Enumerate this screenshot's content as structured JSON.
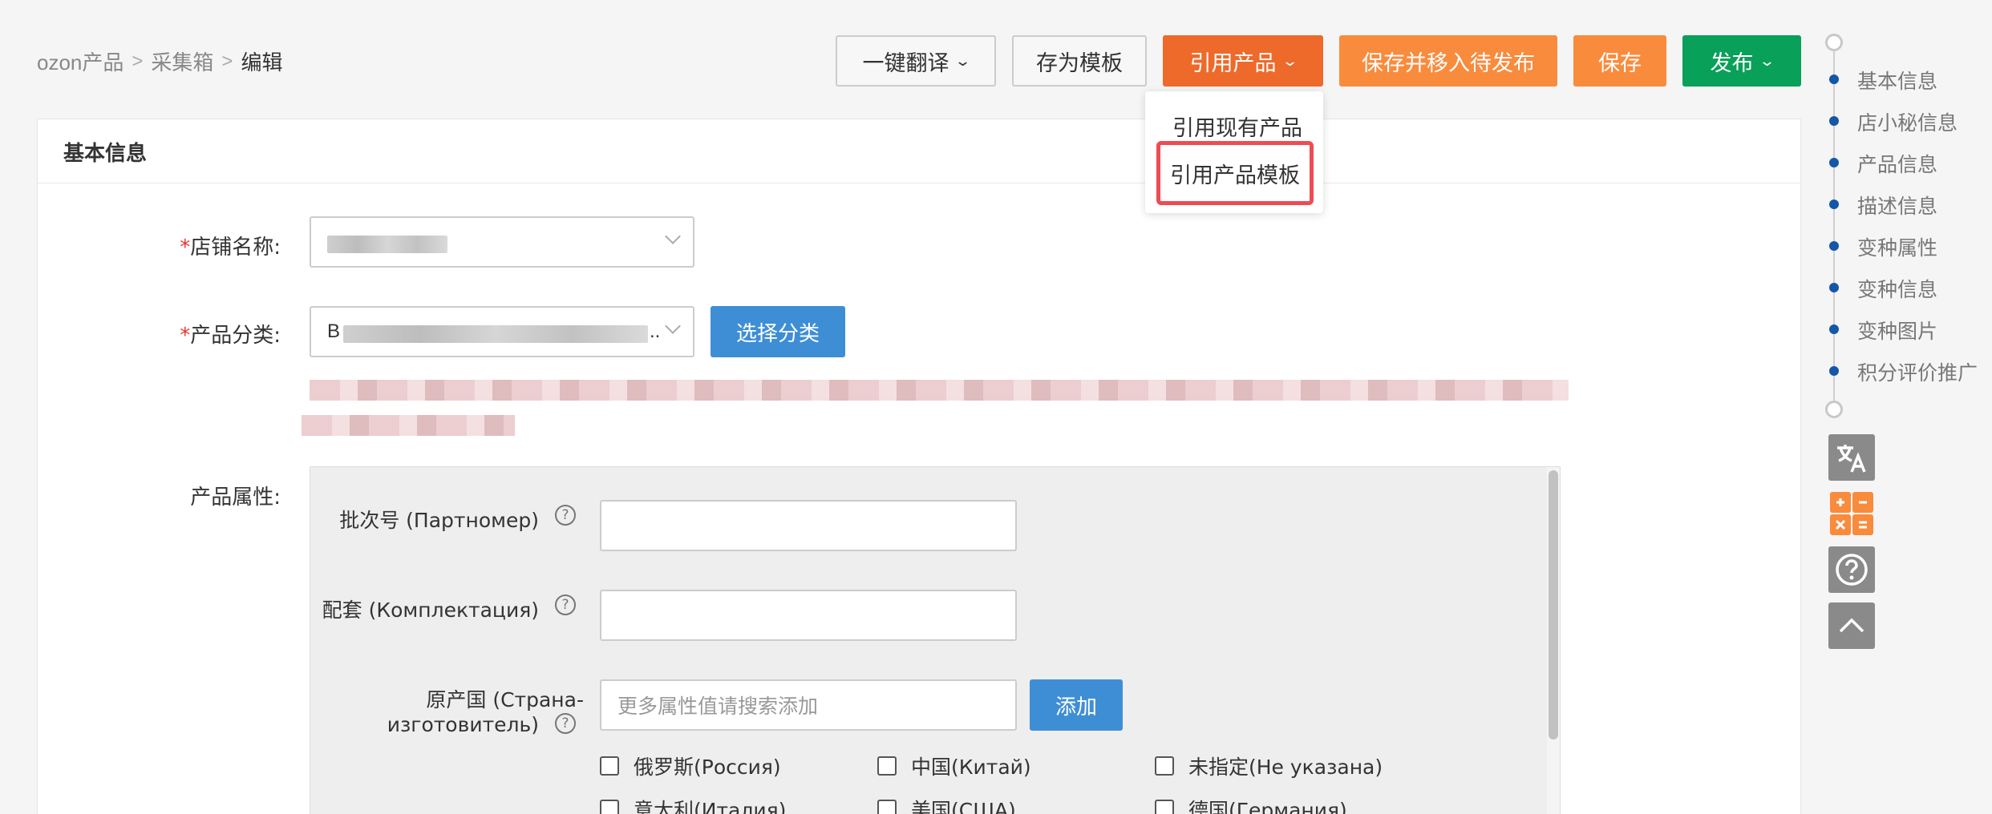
{
  "breadcrumb": {
    "items": [
      "ozon产品",
      "采集箱",
      "编辑"
    ]
  },
  "toolbar": {
    "translate": "一键翻译",
    "save_template": "存为模板",
    "cite_product": "引用产品",
    "save_move": "保存并移入待发布",
    "save": "保存",
    "publish": "发布"
  },
  "dropdown": {
    "items": [
      "引用现有产品",
      "引用产品模板"
    ],
    "highlighted": "引用产品模板",
    "highlight_color": "#ef4b52"
  },
  "section": {
    "title": "基本信息"
  },
  "form": {
    "store_label": "店铺名称:",
    "category_label": "产品分类:",
    "category_prefix": "B",
    "category_suffix": "..",
    "select_category": "选择分类",
    "attr_label": "产品属性:",
    "required_mark": "*"
  },
  "attributes": {
    "batch_label": "批次号 (Партномер)",
    "kit_label": "配套 (Комплектация)",
    "origin_label_1": "原产国 (Страна-",
    "origin_label_2": "изготовитель)",
    "origin_placeholder": "更多属性值请搜索添加",
    "add": "添加",
    "help_icon_glyph": "?",
    "countries": [
      "俄罗斯(Россия)",
      "中国(Китай)",
      "未指定(Не указана)",
      "意大利(Италия)",
      "美国(США)",
      "德国(Германия)"
    ]
  },
  "right_nav": {
    "items": [
      "基本信息",
      "店小秘信息",
      "产品信息",
      "描述信息",
      "变种属性",
      "变种信息",
      "变种图片",
      "积分评价推广"
    ]
  },
  "colors": {
    "orange": "#f98b3c",
    "orange_dark": "#ee6a2a",
    "green": "#09a05a",
    "blue": "#3e8ed6",
    "nav_dot": "#1456a8"
  }
}
